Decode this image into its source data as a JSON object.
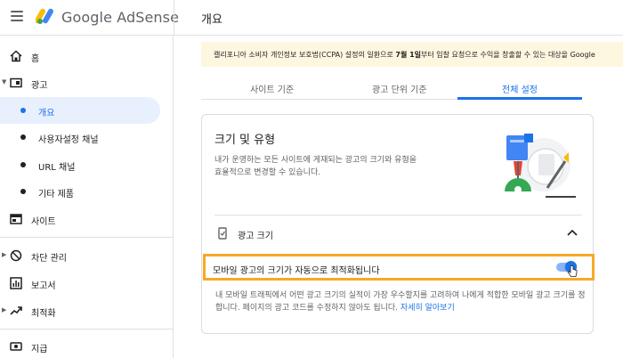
{
  "header": {
    "brand": "Google AdSense",
    "page_title": "개요"
  },
  "sidebar": {
    "items": [
      {
        "label": "홈",
        "icon": "home-icon"
      },
      {
        "label": "광고",
        "icon": "ads-icon"
      },
      {
        "label": "개요"
      },
      {
        "label": "사용자설정 채널"
      },
      {
        "label": "URL 채널"
      },
      {
        "label": "기타 제품"
      },
      {
        "label": "사이트",
        "icon": "sites-icon"
      },
      {
        "label": "차단 관리",
        "icon": "block-icon"
      },
      {
        "label": "보고서",
        "icon": "reports-icon"
      },
      {
        "label": "최적화",
        "icon": "optimization-icon"
      },
      {
        "label": "지급",
        "icon": "payments-icon"
      }
    ]
  },
  "banner": {
    "text_before": "캘리포니아 소비자 개인정보 보호법(CCPA) 설정의 일환으로 ",
    "bold": "7월 1일",
    "text_after": "부터 입찰 요청으로 수익을 창출할 수 있는 대상을 Google"
  },
  "tabs": [
    {
      "label": "사이트 기준"
    },
    {
      "label": "광고 단위 기준"
    },
    {
      "label": "전체 설정"
    }
  ],
  "card": {
    "title": "크기 및 유형",
    "description": "내가 운영하는 모든 사이트에 게재되는 광고의 크기와 유형을 효율적으로 변경할 수 있습니다.",
    "section_title": "광고 크기",
    "setting_label": "모바일 광고의 크기가 자동으로 최적화됩니다",
    "help_text": "내 모바일 트래픽에서 어떤 광고 크기의 실적이 가장 우수할지를 고려하여 나에게 적합한 모바일 광고 크기를 정합니다. 페이지의 광고 코드를 수정하지 않아도 됩니다. ",
    "learn_more": "자세히 알아보기"
  },
  "colors": {
    "accent": "#1a73e8",
    "highlight_border": "#f9a825",
    "banner_bg": "#fef7e0"
  }
}
